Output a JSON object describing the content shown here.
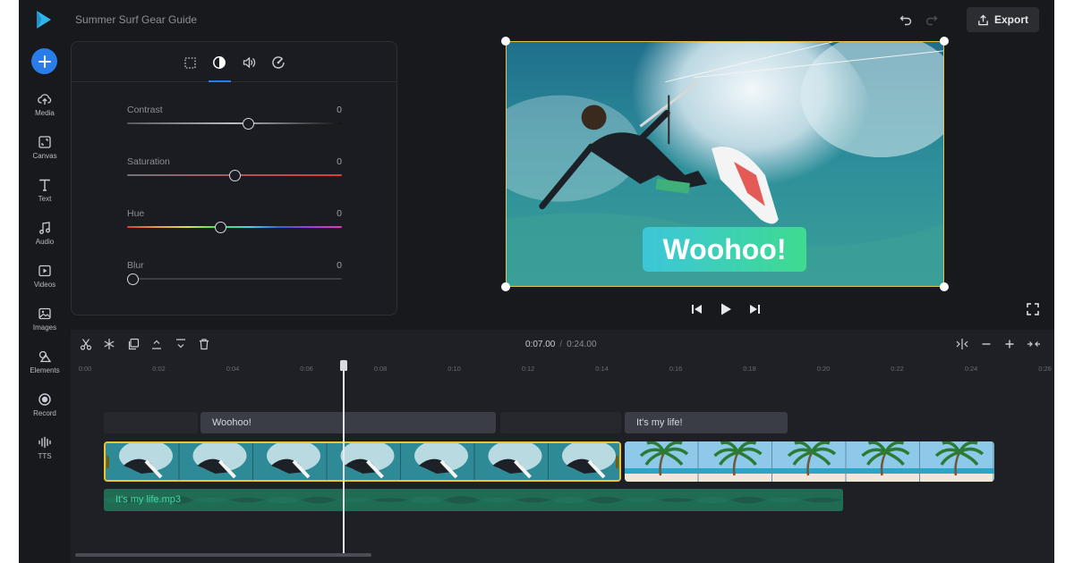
{
  "header": {
    "project_title": "Summer Surf Gear Guide",
    "export_label": "Export"
  },
  "rail": {
    "items": [
      {
        "label": "Media",
        "icon": "upload-cloud-icon"
      },
      {
        "label": "Canvas",
        "icon": "canvas-icon"
      },
      {
        "label": "Text",
        "icon": "text-icon"
      },
      {
        "label": "Audio",
        "icon": "music-note-icon"
      },
      {
        "label": "Videos",
        "icon": "video-icon"
      },
      {
        "label": "Images",
        "icon": "image-icon"
      },
      {
        "label": "Elements",
        "icon": "shapes-icon"
      },
      {
        "label": "Record",
        "icon": "record-icon"
      },
      {
        "label": "TTS",
        "icon": "waveform-icon"
      }
    ]
  },
  "adjust_panel": {
    "tabs": [
      "crop-icon",
      "contrast-icon",
      "volume-icon",
      "speed-icon"
    ],
    "active_tab": 1,
    "rows": [
      {
        "label": "Contrast",
        "value": "0",
        "level": 0.57
      },
      {
        "label": "Saturation",
        "value": "0",
        "level": 0.5
      },
      {
        "label": "Hue",
        "value": "0",
        "level": 0.43
      },
      {
        "label": "Blur",
        "value": "0",
        "level": 0.0
      }
    ]
  },
  "preview": {
    "overlay_text": "Woohoo!"
  },
  "timeline": {
    "current_time": "0:07.00",
    "separator": "/",
    "total_time": "0:24.00",
    "ruler": [
      "0:00",
      "0:02",
      "0:04",
      "0:06",
      "0:08",
      "0:10",
      "0:12",
      "0:14",
      "0:16",
      "0:18",
      "0:20",
      "0:22",
      "0:24",
      "0:26"
    ],
    "text_clips": [
      "Woohoo!",
      "It's my life!"
    ],
    "audio_clip": "It's my life.mp3"
  },
  "colors": {
    "accent": "#2a7ce9",
    "selection": "#f0c330",
    "audio": "#46d69e"
  }
}
